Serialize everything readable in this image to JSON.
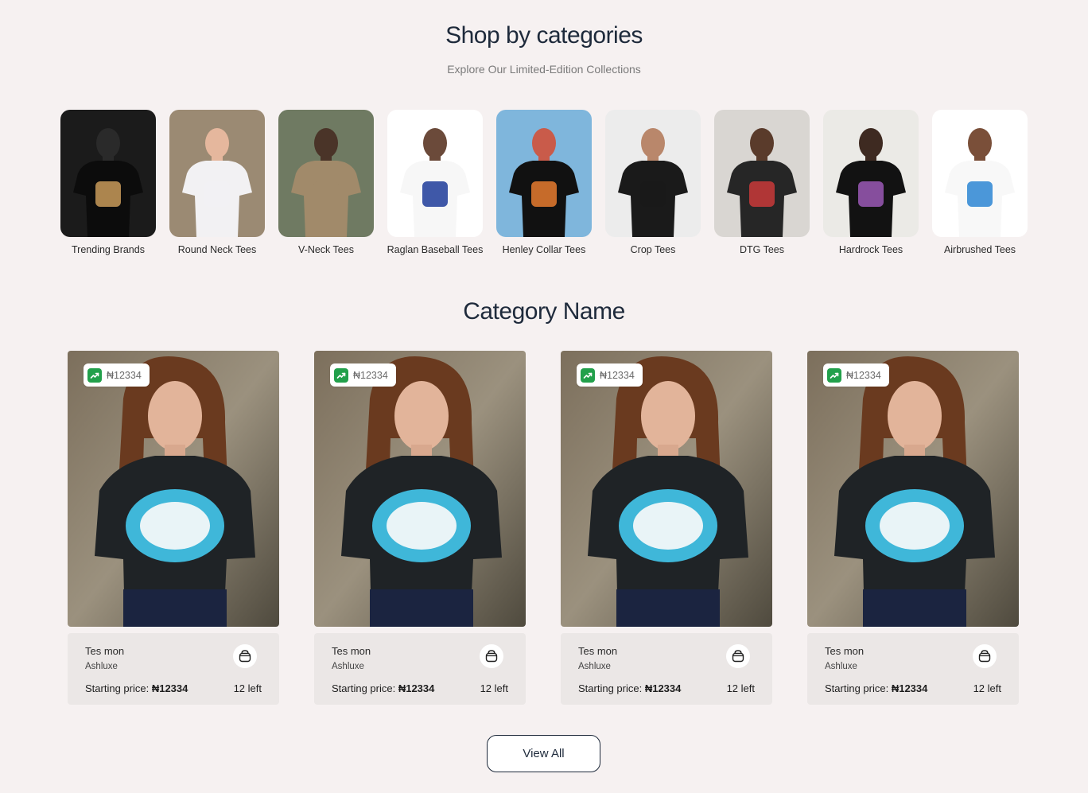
{
  "header": {
    "title": "Shop by categories",
    "subtitle": "Explore Our Limited-Edition Collections"
  },
  "categories": [
    {
      "label": "Trending Brands",
      "bg": "#1b1b1b",
      "shirt": "#0c0c0c",
      "print": "#c99b5a",
      "skin": "#2a2a2a"
    },
    {
      "label": "Round Neck Tees",
      "bg": "#9b8a73",
      "shirt": "#f2f1f3",
      "print": "#f2f1f3",
      "skin": "#e5b79d"
    },
    {
      "label": "V-Neck Tees",
      "bg": "#6f7a62",
      "shirt": "#a18a6a",
      "print": "#a18a6a",
      "skin": "#4a3428"
    },
    {
      "label": "Raglan Baseball Tees",
      "bg": "#ffffff",
      "shirt": "#f7f7f7",
      "print": "#1f3c9a",
      "skin": "#6b4a3a"
    },
    {
      "label": "Henley Collar Tees",
      "bg": "#7fb6dc",
      "shirt": "#111111",
      "print": "#e67b2f",
      "skin": "#c95b4a"
    },
    {
      "label": "Crop Tees",
      "bg": "#ececec",
      "shirt": "#1a1a1a",
      "print": "#1a1a1a",
      "skin": "#b9876b"
    },
    {
      "label": "DTG Tees",
      "bg": "#d9d6d2",
      "shirt": "#262626",
      "print": "#c93a3a",
      "skin": "#5a3b2b"
    },
    {
      "label": "Hardrock Tees",
      "bg": "#ebeae6",
      "shirt": "#121212",
      "print": "#9b59b6",
      "skin": "#3e2a21"
    },
    {
      "label": "Airbrushed Tees",
      "bg": "#ffffff",
      "shirt": "#f8f8f8",
      "print": "#2d86d4",
      "skin": "#7a4f39"
    }
  ],
  "section": {
    "title": "Category Name"
  },
  "products": [
    {
      "price_badge": "₦12334",
      "name": "Tes mon",
      "brand": "Ashluxe",
      "starting_label": "Starting price:",
      "starting_price": "₦12334",
      "stock": "12 left"
    },
    {
      "price_badge": "₦12334",
      "name": "Tes mon",
      "brand": "Ashluxe",
      "starting_label": "Starting price:",
      "starting_price": "₦12334",
      "stock": "12 left"
    },
    {
      "price_badge": "₦12334",
      "name": "Tes mon",
      "brand": "Ashluxe",
      "starting_label": "Starting price:",
      "starting_price": "₦12334",
      "stock": "12 left"
    },
    {
      "price_badge": "₦12334",
      "name": "Tes mon",
      "brand": "Ashluxe",
      "starting_label": "Starting price:",
      "starting_price": "₦12334",
      "stock": "12 left"
    }
  ],
  "view_all_label": "View All",
  "colors": {
    "background": "#f6f1f1",
    "heading": "#1e2a3b",
    "trend_green": "#22a04b",
    "card_info": "#ebe7e6"
  },
  "icons": {
    "trend": "trending-up-icon",
    "bag": "shopping-bag-icon"
  }
}
